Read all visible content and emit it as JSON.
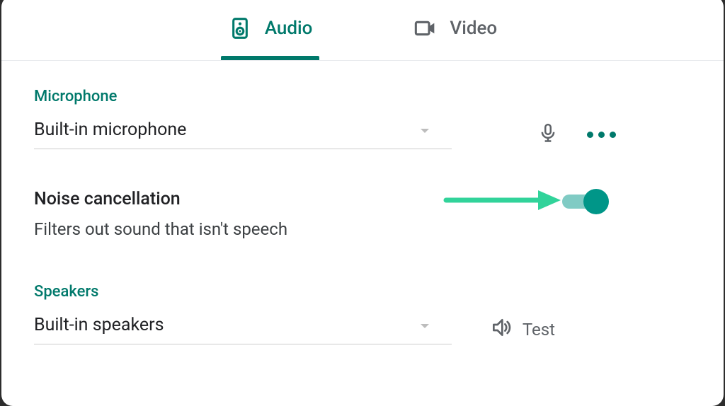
{
  "tabs": {
    "audio": {
      "label": "Audio"
    },
    "video": {
      "label": "Video"
    }
  },
  "microphone": {
    "section_label": "Microphone",
    "selected": "Built-in microphone"
  },
  "noise_cancellation": {
    "title": "Noise cancellation",
    "description": "Filters out sound that isn't speech",
    "enabled": true
  },
  "speakers": {
    "section_label": "Speakers",
    "selected": "Built-in speakers",
    "test_label": "Test"
  },
  "colors": {
    "accent": "#009688",
    "teal_dark": "#00796B",
    "arrow": "#31D39A"
  }
}
